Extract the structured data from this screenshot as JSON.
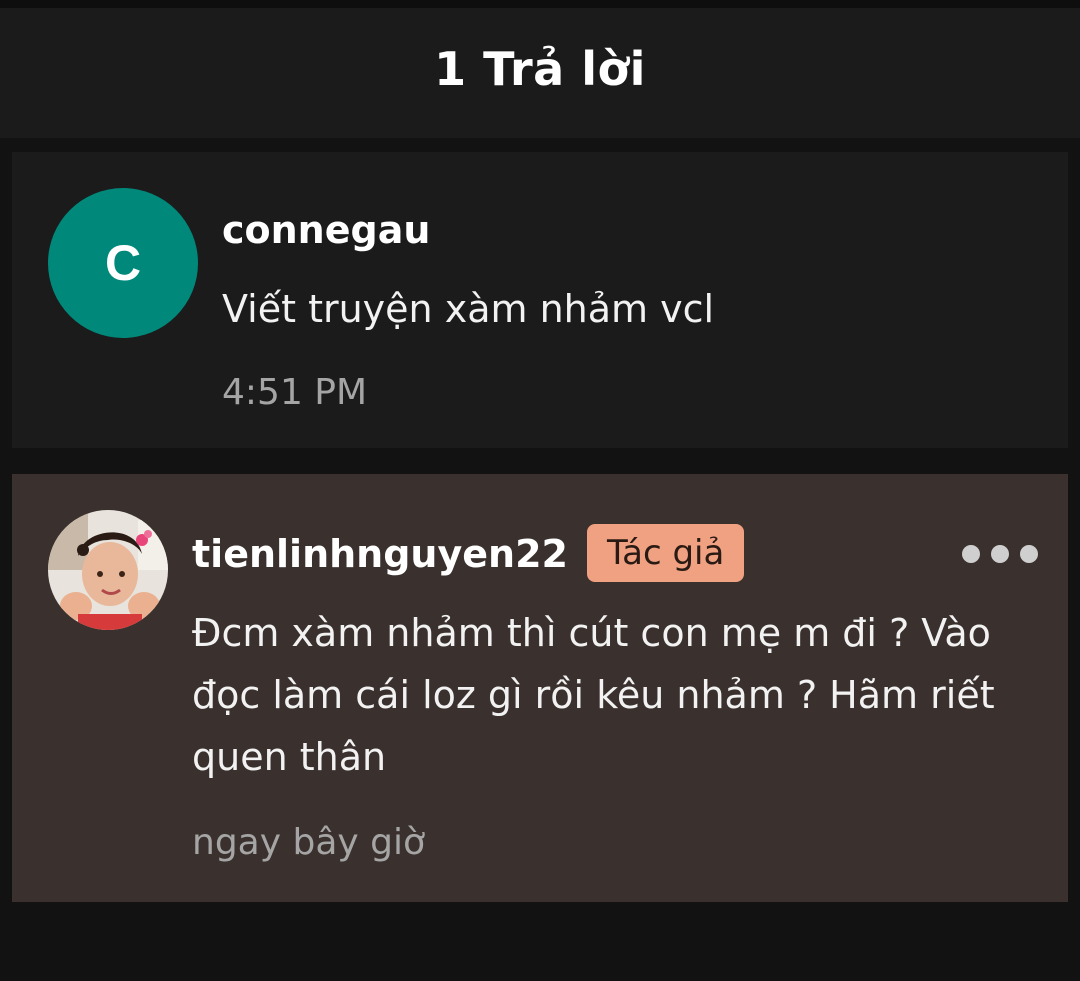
{
  "header": {
    "title": "1 Trả lời"
  },
  "parent_comment": {
    "avatar_letter": "C",
    "avatar_color": "#00897b",
    "username": "connegau",
    "text": "Viết truyện xàm nhảm vcl",
    "time": "4:51 PM"
  },
  "reply": {
    "username": "tienlinhnguyen22",
    "badge": "Tác giả",
    "badge_color": "#f0a182",
    "text": "Đcm xàm nhảm thì cút con mẹ m đi ? Vào đọc làm cái loz gì rồi kêu nhảm ? Hãm riết quen thân",
    "time": "ngay bây giờ",
    "more_icon": "more-horizontal-icon"
  }
}
